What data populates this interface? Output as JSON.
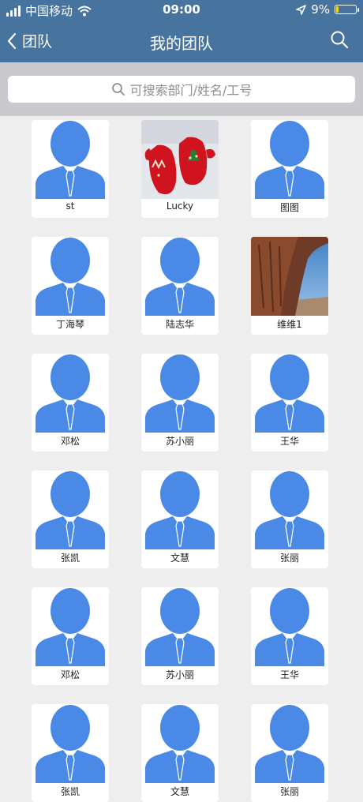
{
  "status_bar": {
    "carrier": "中国移动",
    "time": "09:00",
    "battery": "9%",
    "battery_level": 0.09
  },
  "nav": {
    "back_label": "团队",
    "title": "我的团队"
  },
  "search": {
    "placeholder": "可搜索部门/姓名/工号"
  },
  "members": [
    {
      "name": "st",
      "avatar": "person-silhouette"
    },
    {
      "name": "Lucky",
      "avatar": "photo-red-mittens"
    },
    {
      "name": "图图",
      "avatar": "person-silhouette"
    },
    {
      "name": "丁海琴",
      "avatar": "person-silhouette"
    },
    {
      "name": "陆志华",
      "avatar": "person-silhouette"
    },
    {
      "name": "维维1",
      "avatar": "photo-canyon-rock"
    },
    {
      "name": "邓松",
      "avatar": "person-silhouette"
    },
    {
      "name": "苏小丽",
      "avatar": "person-silhouette"
    },
    {
      "name": "王华",
      "avatar": "person-silhouette"
    },
    {
      "name": "张凯",
      "avatar": "person-silhouette"
    },
    {
      "name": "文慧",
      "avatar": "person-silhouette"
    },
    {
      "name": "张丽",
      "avatar": "person-silhouette"
    },
    {
      "name": "邓松",
      "avatar": "person-silhouette"
    },
    {
      "name": "苏小丽",
      "avatar": "person-silhouette"
    },
    {
      "name": "王华",
      "avatar": "person-silhouette"
    },
    {
      "name": "张凯",
      "avatar": "person-silhouette"
    },
    {
      "name": "文慧",
      "avatar": "person-silhouette"
    },
    {
      "name": "张丽",
      "avatar": "person-silhouette"
    }
  ],
  "colors": {
    "header": "#47739f",
    "avatar_blue": "#4a8ae6",
    "background": "#eeeeee"
  }
}
